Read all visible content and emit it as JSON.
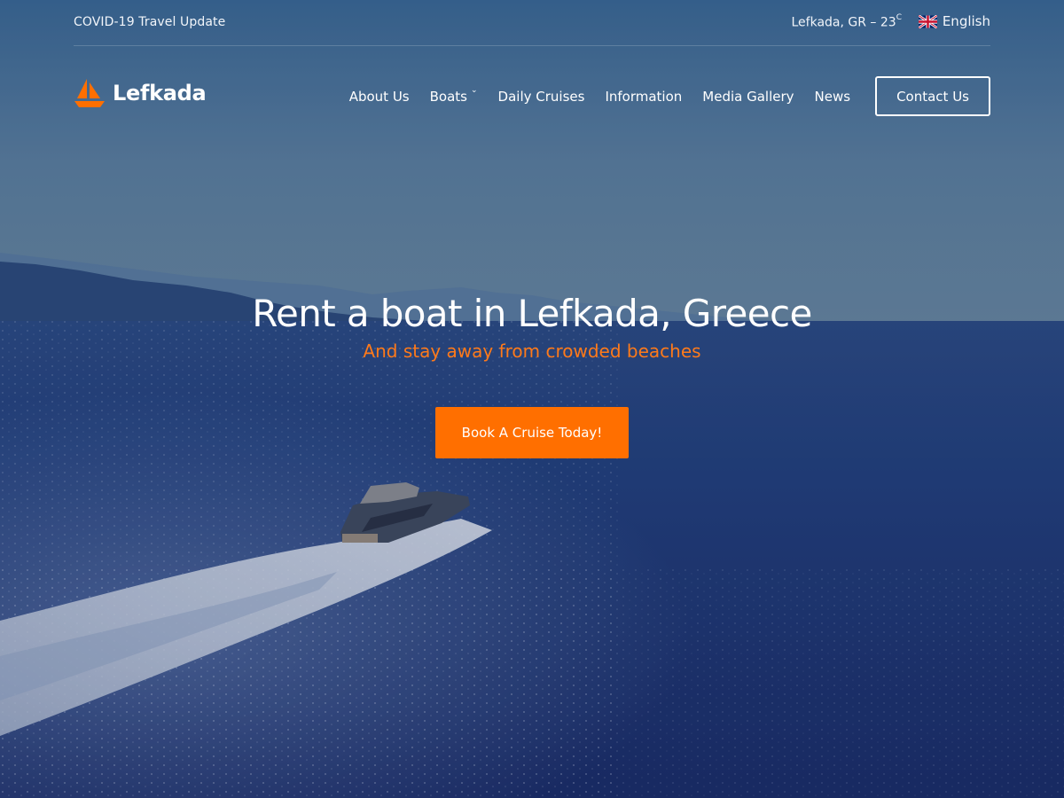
{
  "topbar": {
    "covid_link": "COVID-19 Travel Update",
    "weather": {
      "location": "Lefkada, GR",
      "separator": "–",
      "temperature": "23",
      "unit": "C"
    },
    "language": {
      "label": "English",
      "icon": "uk-flag-icon"
    }
  },
  "navbar": {
    "logo": {
      "text": "Lefkada",
      "icon": "sailboat-icon"
    },
    "items": [
      {
        "label": "About Us"
      },
      {
        "label": "Boats",
        "has_dropdown": true,
        "dropdown_icon": "chevron-down-icon"
      },
      {
        "label": "Daily Cruises"
      },
      {
        "label": "Information"
      },
      {
        "label": "Media Gallery"
      },
      {
        "label": "News"
      }
    ],
    "contact_button": "Contact Us",
    "chevron_glyph": "⌄"
  },
  "hero": {
    "title": "Rent a boat in Lefkada, Greece",
    "subtitle": "And stay away from crowded beaches",
    "cta_label": "Book A Cruise Today!"
  },
  "colors": {
    "accent": "#ff6f00",
    "subtitle": "#ff7a1a",
    "sky_top": "#3d6894",
    "sea_deep": "#1c2f6b"
  }
}
